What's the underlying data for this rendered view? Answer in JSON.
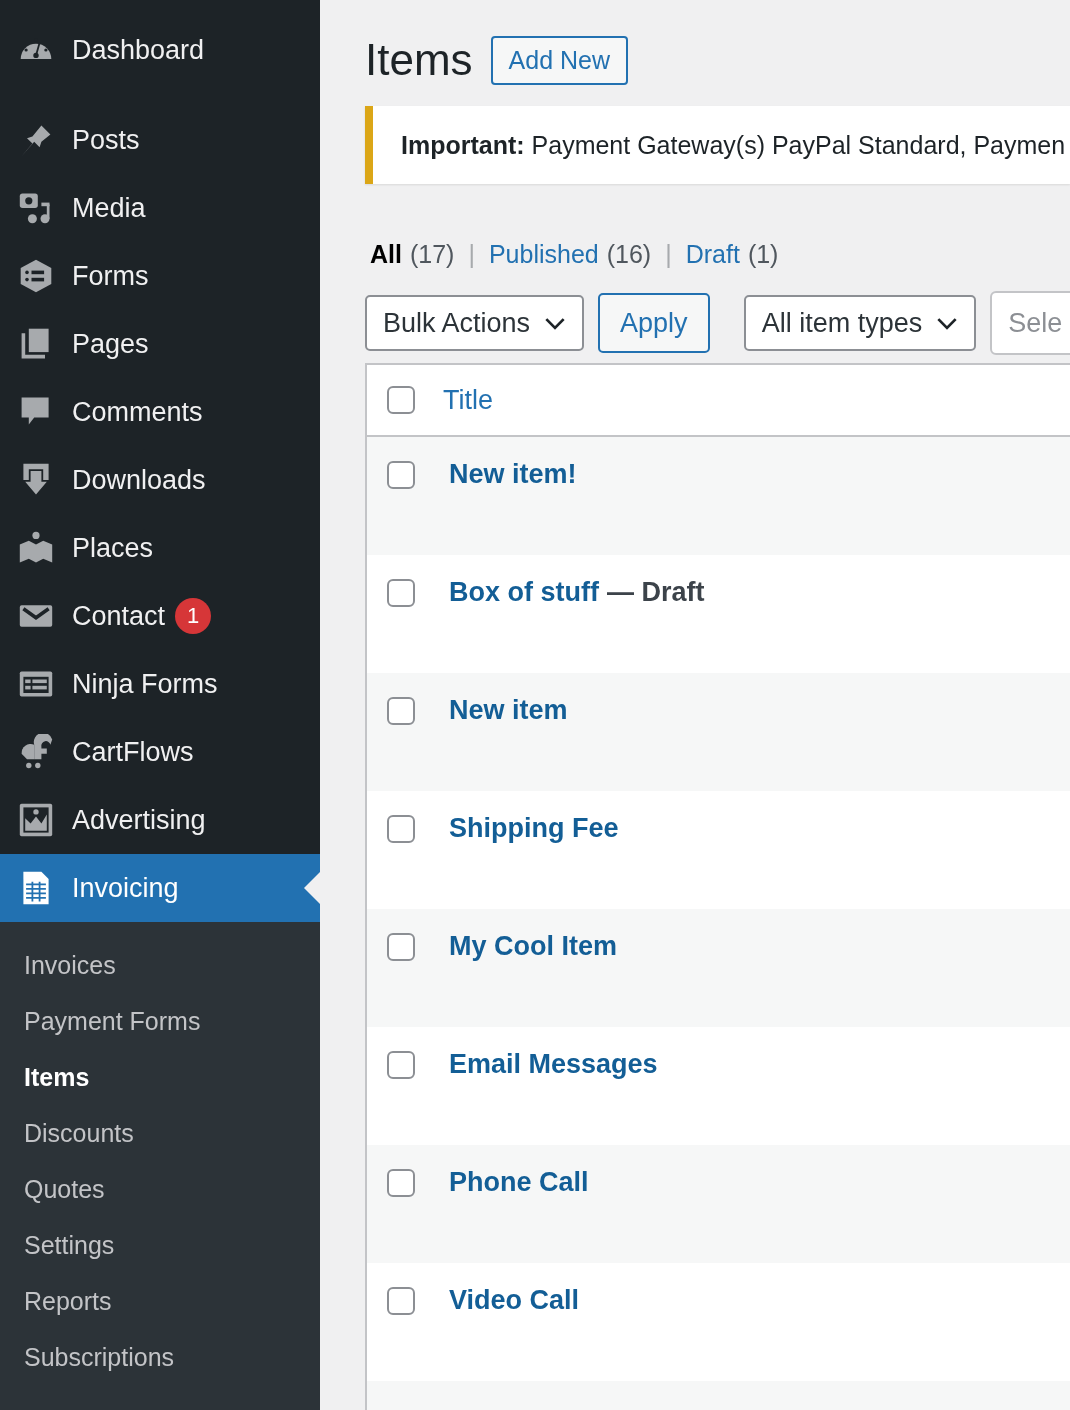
{
  "sidebar": {
    "menu": [
      {
        "label": "Dashboard",
        "selected": false
      },
      {
        "label": "Posts",
        "selected": false
      },
      {
        "label": "Media",
        "selected": false
      },
      {
        "label": "Forms",
        "selected": false
      },
      {
        "label": "Pages",
        "selected": false
      },
      {
        "label": "Comments",
        "selected": false
      },
      {
        "label": "Downloads",
        "selected": false
      },
      {
        "label": "Places",
        "selected": false
      },
      {
        "label": "Contact",
        "selected": false,
        "badge": "1"
      },
      {
        "label": "Ninja Forms",
        "selected": false
      },
      {
        "label": "CartFlows",
        "selected": false
      },
      {
        "label": "Advertising",
        "selected": false
      },
      {
        "label": "Invoicing",
        "selected": true
      }
    ],
    "submenu": [
      {
        "label": "Invoices",
        "selected": false
      },
      {
        "label": "Payment Forms",
        "selected": false
      },
      {
        "label": "Items",
        "selected": true
      },
      {
        "label": "Discounts",
        "selected": false
      },
      {
        "label": "Quotes",
        "selected": false
      },
      {
        "label": "Settings",
        "selected": false
      },
      {
        "label": "Reports",
        "selected": false
      },
      {
        "label": "Subscriptions",
        "selected": false
      }
    ]
  },
  "page": {
    "title": "Items",
    "add_new": "Add New"
  },
  "notice": {
    "text": "**Important:** Payment Gateway(s) PayPal Standard, Paymen"
  },
  "filters": [
    {
      "label": "All",
      "count": "(17)",
      "selected": true
    },
    {
      "separator": "|",
      "label": "Published",
      "count": "(16)",
      "selected": false
    },
    {
      "separator": "|",
      "label": "Draft",
      "count": "(1)",
      "selected": false
    }
  ],
  "toolbar": {
    "bulk_actions": "Bulk Actions",
    "apply": "Apply",
    "item_types": "All item types",
    "select_placeholder": "Sele"
  },
  "table": {
    "select_all_checked": false,
    "columns": [
      {
        "label": "Title"
      }
    ],
    "rows": [
      {
        "title": "New item!",
        "checked": false
      },
      {
        "title": "Box of stuff",
        "post_state": "— Draft",
        "checked": false
      },
      {
        "title": "New item",
        "checked": false
      },
      {
        "title": "Shipping Fee",
        "checked": false
      },
      {
        "title": "My Cool Item",
        "checked": false
      },
      {
        "title": "Email Messages",
        "checked": false
      },
      {
        "title": "Phone Call",
        "checked": false
      },
      {
        "title": "Video Call",
        "checked": false
      }
    ]
  }
}
